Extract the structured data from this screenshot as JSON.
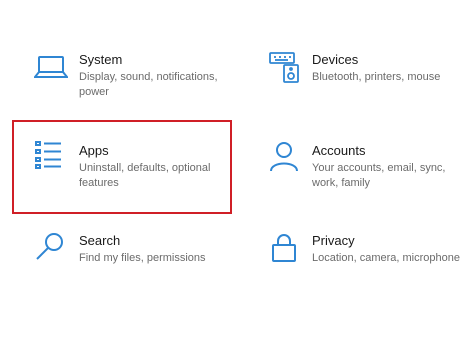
{
  "settings": {
    "accent_color": "#2f86d3",
    "highlight_color": "#d01f26",
    "tiles": [
      {
        "icon": "laptop-icon",
        "title": "System",
        "description": "Display, sound, notifications, power"
      },
      {
        "icon": "keyboard-speaker-icon",
        "title": "Devices",
        "description": "Bluetooth, printers, mouse"
      },
      {
        "icon": "apps-list-icon",
        "title": "Apps",
        "description": "Uninstall, defaults, optional features"
      },
      {
        "icon": "person-icon",
        "title": "Accounts",
        "description": "Your accounts, email, sync, work, family"
      },
      {
        "icon": "search-icon",
        "title": "Search",
        "description": "Find my files, permissions"
      },
      {
        "icon": "lock-icon",
        "title": "Privacy",
        "description": "Location, camera, microphone"
      }
    ]
  }
}
